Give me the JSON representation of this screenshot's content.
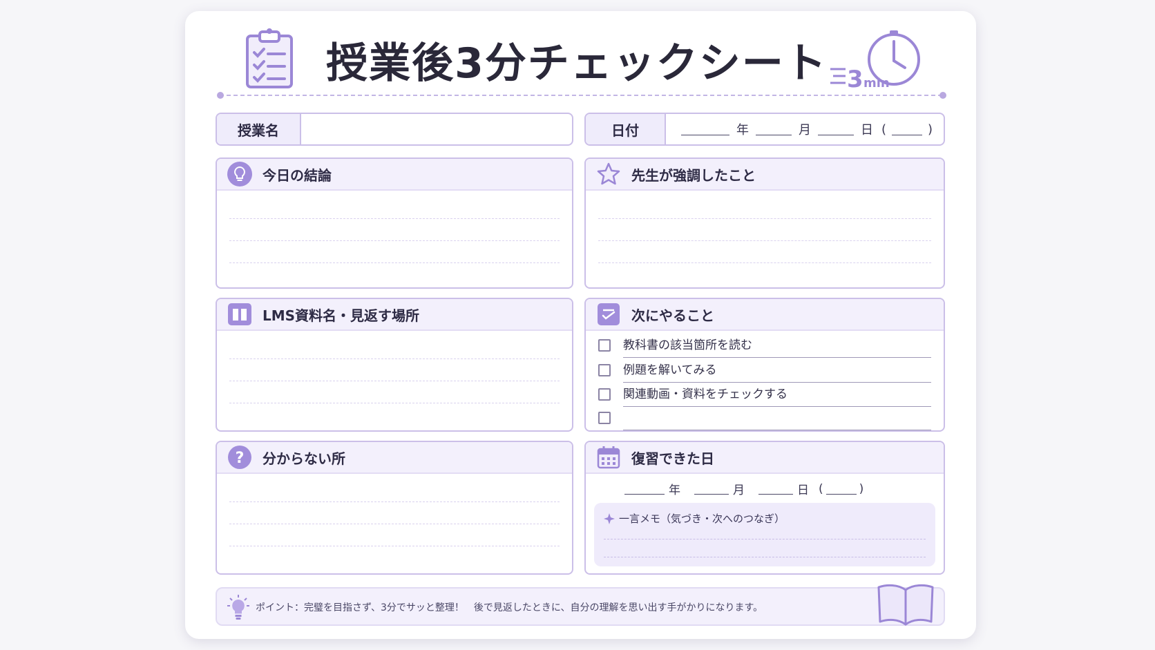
{
  "header": {
    "title": "授業後3分チェックシート",
    "timer_number": "3",
    "timer_unit": "min"
  },
  "fields": {
    "class_name_label": "授業名",
    "date_label": "日付",
    "date_year": "年",
    "date_month": "月",
    "date_day": "日",
    "date_open": "(",
    "date_close": ")"
  },
  "sections": {
    "conclusion": {
      "title": "今日の結論",
      "icon": "lightbulb-icon"
    },
    "emphasis": {
      "title": "先生が強調したこと",
      "icon": "star-icon"
    },
    "lms": {
      "title": "LMS資料名・見返す場所",
      "icon": "book-icon"
    },
    "next": {
      "title": "次にやること",
      "icon": "checklist-icon",
      "items": [
        "教科書の該当箇所を読む",
        "例題を解いてみる",
        "関連動画・資料をチェックする",
        ""
      ]
    },
    "unclear": {
      "title": "分からない所",
      "icon": "question-icon"
    },
    "review": {
      "title": "復習できた日",
      "icon": "calendar-icon",
      "year": "年",
      "month": "月",
      "day": "日",
      "open": "(",
      "close": ")",
      "memo_title": "一言メモ（気づき・次へのつなぎ）"
    }
  },
  "footer": {
    "tip": "ポイント：完璧を目指さず、3分でサッと整理！　後で見返したときに、自分の理解を思い出す手がかりになります。"
  },
  "colors": {
    "accent": "#9b87d6",
    "border": "#cbbfe8",
    "header_fill": "#f3f0fc"
  }
}
